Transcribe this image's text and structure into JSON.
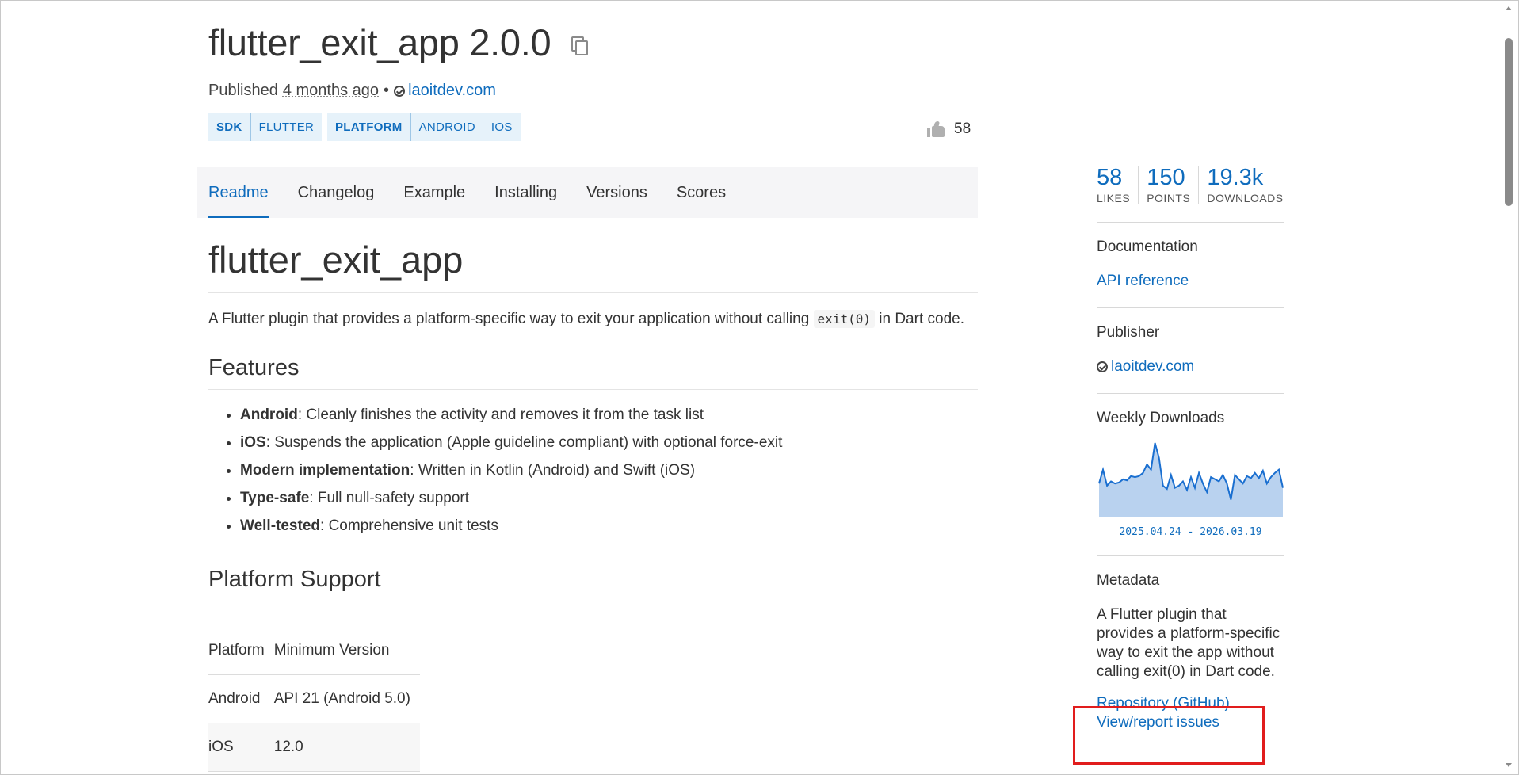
{
  "header": {
    "title": "flutter_exit_app 2.0.0",
    "published_prefix": "Published",
    "published_ago": "4 months ago",
    "separator": "•",
    "publisher": "laoitdev.com",
    "likes": "58"
  },
  "tags": {
    "sdk_label": "SDK",
    "sdk_values": [
      "FLUTTER"
    ],
    "platform_label": "PLATFORM",
    "platform_values": [
      "ANDROID",
      "IOS"
    ]
  },
  "tabs": [
    {
      "label": "Readme",
      "active": true
    },
    {
      "label": "Changelog",
      "active": false
    },
    {
      "label": "Example",
      "active": false
    },
    {
      "label": "Installing",
      "active": false
    },
    {
      "label": "Versions",
      "active": false
    },
    {
      "label": "Scores",
      "active": false
    }
  ],
  "readme": {
    "heading": "flutter_exit_app",
    "desc_before": "A Flutter plugin that provides a platform-specific way to exit your application without calling ",
    "desc_code": "exit(0)",
    "desc_after": " in Dart code.",
    "features_heading": "Features",
    "features": [
      {
        "bold": "Android",
        "text": ": Cleanly finishes the activity and removes it from the task list"
      },
      {
        "bold": "iOS",
        "text": ": Suspends the application (Apple guideline compliant) with optional force-exit"
      },
      {
        "bold": "Modern implementation",
        "text": ": Written in Kotlin (Android) and Swift (iOS)"
      },
      {
        "bold": "Type-safe",
        "text": ": Full null-safety support"
      },
      {
        "bold": "Well-tested",
        "text": ": Comprehensive unit tests"
      }
    ],
    "platform_heading": "Platform Support",
    "table": {
      "headers": [
        "Platform",
        "Minimum Version"
      ],
      "rows": [
        [
          "Android",
          "API 21 (Android 5.0)"
        ],
        [
          "iOS",
          "12.0"
        ]
      ]
    }
  },
  "sidebar": {
    "stats": [
      {
        "value": "58",
        "label": "LIKES"
      },
      {
        "value": "150",
        "label": "POINTS"
      },
      {
        "value": "19.3k",
        "label": "DOWNLOADS"
      }
    ],
    "documentation_heading": "Documentation",
    "api_reference": "API reference",
    "publisher_heading": "Publisher",
    "publisher": "laoitdev.com",
    "weekly_heading": "Weekly Downloads",
    "weekly_range": "2025.04.24 - 2026.03.19",
    "metadata_heading": "Metadata",
    "metadata_desc": "A Flutter plugin that provides a platform-specific way to exit the app without calling exit(0) in Dart code.",
    "repo_link": "Repository (GitHub)",
    "issues_link": "View/report issues"
  },
  "colors": {
    "link": "#0f6cbd",
    "tag_bg": "#e6f2fa",
    "highlight": "#e11d1d",
    "chart_fill": "#b9d2ef",
    "chart_line": "#1a6fd0"
  },
  "chart_data": {
    "type": "area",
    "title": "",
    "x_range": [
      "2025.04.24",
      "2026.03.19"
    ],
    "values": [
      20,
      33,
      18,
      22,
      20,
      21,
      24,
      23,
      27,
      26,
      27,
      30,
      38,
      33,
      58,
      44,
      18,
      15,
      28,
      16,
      18,
      22,
      14,
      26,
      16,
      30,
      20,
      12,
      26,
      24,
      22,
      28,
      20,
      5,
      28,
      24,
      20,
      27,
      25,
      30,
      25,
      32,
      20,
      26,
      30,
      33,
      16
    ]
  }
}
